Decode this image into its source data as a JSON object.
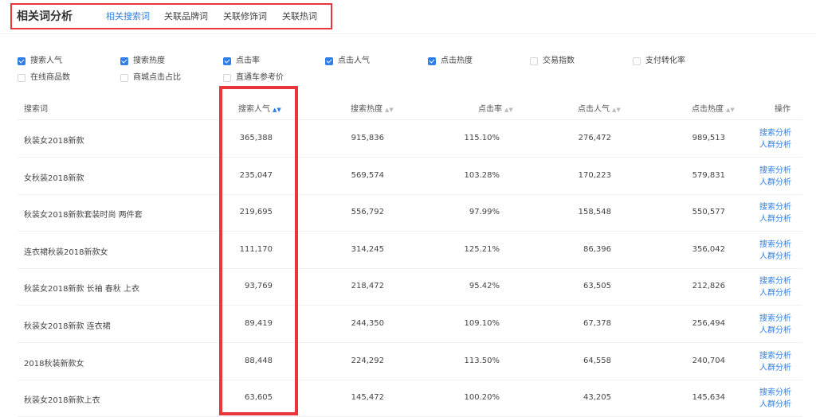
{
  "title": "相关词分析",
  "tabs": [
    "相关搜索词",
    "关联品牌词",
    "关联修饰词",
    "关联热词"
  ],
  "active_tab": 0,
  "filters": [
    {
      "label": "搜索人气",
      "checked": true
    },
    {
      "label": "搜索热度",
      "checked": true
    },
    {
      "label": "点击率",
      "checked": true
    },
    {
      "label": "点击人气",
      "checked": true
    },
    {
      "label": "点击热度",
      "checked": true
    },
    {
      "label": "交易指数",
      "checked": false
    },
    {
      "label": "支付转化率",
      "checked": false
    },
    {
      "label": "在线商品数",
      "checked": false
    },
    {
      "label": "商城点击占比",
      "checked": false
    },
    {
      "label": "直通车参考价",
      "checked": false
    }
  ],
  "table": {
    "headers": [
      "搜索词",
      "搜索人气",
      "搜索热度",
      "点击率",
      "点击人气",
      "点击热度",
      "操作"
    ],
    "rows": [
      {
        "keyword": "秋装女2018新款",
        "search_popularity": "365,388",
        "search_heat": "915,836",
        "ctr": "115.10%",
        "click_popularity": "276,472",
        "click_heat": "989,513"
      },
      {
        "keyword": "女秋装2018新款",
        "search_popularity": "235,047",
        "search_heat": "569,574",
        "ctr": "103.28%",
        "click_popularity": "170,223",
        "click_heat": "579,831"
      },
      {
        "keyword": "秋装女2018新款套装时尚 两件套",
        "search_popularity": "219,695",
        "search_heat": "556,792",
        "ctr": "97.99%",
        "click_popularity": "158,548",
        "click_heat": "550,577"
      },
      {
        "keyword": "连衣裙秋装2018新款女",
        "search_popularity": "111,170",
        "search_heat": "314,245",
        "ctr": "125.21%",
        "click_popularity": "86,396",
        "click_heat": "356,042"
      },
      {
        "keyword": "秋装女2018新款 长袖 春秋 上衣",
        "search_popularity": "93,769",
        "search_heat": "218,472",
        "ctr": "95.42%",
        "click_popularity": "63,505",
        "click_heat": "212,826"
      },
      {
        "keyword": "秋装女2018新款 连衣裙",
        "search_popularity": "89,419",
        "search_heat": "244,350",
        "ctr": "109.10%",
        "click_popularity": "67,378",
        "click_heat": "256,494"
      },
      {
        "keyword": "2018秋装新款女",
        "search_popularity": "88,448",
        "search_heat": "224,292",
        "ctr": "113.50%",
        "click_popularity": "64,558",
        "click_heat": "240,704"
      },
      {
        "keyword": "秋装女2018新款上衣",
        "search_popularity": "63,605",
        "search_heat": "145,472",
        "ctr": "100.20%",
        "click_popularity": "43,205",
        "click_heat": "145,634"
      }
    ],
    "actions": [
      "搜索分析",
      "人群分析"
    ]
  },
  "colors": {
    "accent": "#2f7fe6",
    "highlight": "#e8363b"
  }
}
